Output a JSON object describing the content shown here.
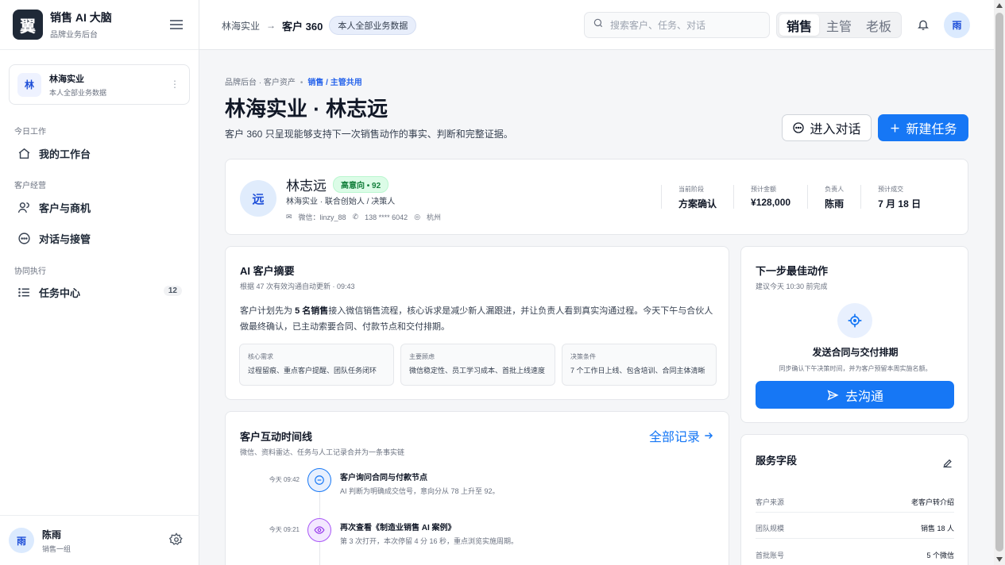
{
  "brand": {
    "logo": "翼",
    "title": "销售 AI 大脑",
    "subtitle": "品牌业务后台"
  },
  "org": {
    "avatar": "林",
    "name": "林海实业",
    "subtitle": "本人全部业务数据"
  },
  "nav": {
    "section_today": "今日工作",
    "workbench": "我的工作台",
    "section_customers": "客户经营",
    "customers": "客户与商机",
    "conversations": "对话与接管",
    "section_collab": "协同执行",
    "tasks": "任务中心",
    "tasks_count": "12"
  },
  "user": {
    "avatar": "雨",
    "name": "陈雨",
    "team": "销售一组"
  },
  "topbar": {
    "crumb_root": "林海实业",
    "crumb_arrow": "→",
    "crumb_current": "客户 360",
    "crumb_pill": "本人全部业务数据",
    "search_placeholder": "搜索客户、任务、对话",
    "roles": [
      "销售",
      "主管",
      "老板"
    ],
    "avatar": "雨"
  },
  "page": {
    "crumb_a": "品牌后台 · 客户资产",
    "crumb_dot": "•",
    "crumb_hl": "销售 / 主管共用",
    "title": "林海实业 · 林志远",
    "description": "客户 360 只呈现能够支持下一次销售动作的事实、判断和完整证据。",
    "btn_chat": "进入对话",
    "btn_new_task": "新建任务"
  },
  "profile": {
    "avatar": "远",
    "name": "林志远",
    "tag": "高意向 • 92",
    "role": "林海实业 · 联合创始人 / 决策人",
    "wechat": "微信：linzy_88",
    "phone": "138 **** 6042",
    "city": "杭州",
    "stats": [
      {
        "label": "当前阶段",
        "value": "方案确认"
      },
      {
        "label": "预计金额",
        "value": "¥128,000"
      },
      {
        "label": "负责人",
        "value": "陈雨"
      },
      {
        "label": "预计成交",
        "value": "7 月 18 日"
      }
    ]
  },
  "summary": {
    "title": "AI 客户摘要",
    "subtitle": "根据 47 次有效沟通自动更新 · 09:43",
    "body_a": "客户计划先为 ",
    "body_b": "5 名销售",
    "body_c": "接入微信销售流程，核心诉求是减少新人漏跟进，并让负责人看到真实沟通过程。今天下午与合伙人做最终确认，已主动索要合同、付款节点和交付排期。",
    "tiles": [
      {
        "label": "核心需求",
        "value": "过程留痕、重点客户提醒、团队任务闭环"
      },
      {
        "label": "主要顾虑",
        "value": "微信稳定性、员工学习成本、首批上线速度"
      },
      {
        "label": "决策条件",
        "value": "7 个工作日上线、包含培训、合同主体清晰"
      }
    ]
  },
  "next_action": {
    "title": "下一步最佳动作",
    "subtitle": "建议今天 10:30 前完成",
    "action_title": "发送合同与交付排期",
    "action_desc": "同步确认下午决策时间，并为客户预留本周实施名额。",
    "button": "去沟通"
  },
  "timeline": {
    "title": "客户互动时间线",
    "subtitle": "微信、资料雷达、任务与人工记录合并为一条事实链",
    "all_link": "全部记录",
    "items": [
      {
        "time": "今天 09:42",
        "title": "客户询问合同与付款节点",
        "desc": "AI 判断为明确成交信号，意向分从 78 上升至 92。"
      },
      {
        "time": "今天 09:21",
        "title": "再次查看《制造业销售 AI 案例》",
        "desc": "第 3 次打开，本次停留 4 分 16 秒，重点浏览实施周期。"
      }
    ]
  },
  "service": {
    "title": "服务字段",
    "rows": [
      {
        "k": "客户来源",
        "v": "老客户转介绍"
      },
      {
        "k": "团队规模",
        "v": "销售 18 人"
      },
      {
        "k": "首批账号",
        "v": "5 个微信"
      }
    ]
  },
  "colors": {
    "primary": "#1677f5",
    "accent_text": "#2563eb",
    "tag_green": "#15803d",
    "dark_logo": "#1f2937"
  },
  "icons": [
    "menu-collapse-icon",
    "more-vertical-icon",
    "home-icon",
    "users-icon",
    "chat-icon",
    "list-icon",
    "gear-icon",
    "search-icon",
    "bell-icon",
    "plus-icon",
    "wechat-icon",
    "phone-icon",
    "globe-icon",
    "target-icon",
    "send-icon",
    "arrow-right-icon",
    "edit-icon",
    "eye-icon"
  ]
}
